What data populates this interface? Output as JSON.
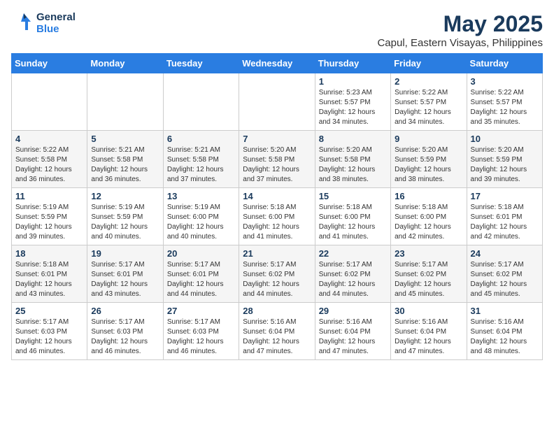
{
  "header": {
    "logo_line1": "General",
    "logo_line2": "Blue",
    "month": "May 2025",
    "location": "Capul, Eastern Visayas, Philippines"
  },
  "weekdays": [
    "Sunday",
    "Monday",
    "Tuesday",
    "Wednesday",
    "Thursday",
    "Friday",
    "Saturday"
  ],
  "weeks": [
    [
      {
        "day": "",
        "detail": ""
      },
      {
        "day": "",
        "detail": ""
      },
      {
        "day": "",
        "detail": ""
      },
      {
        "day": "",
        "detail": ""
      },
      {
        "day": "1",
        "detail": "Sunrise: 5:23 AM\nSunset: 5:57 PM\nDaylight: 12 hours\nand 34 minutes."
      },
      {
        "day": "2",
        "detail": "Sunrise: 5:22 AM\nSunset: 5:57 PM\nDaylight: 12 hours\nand 34 minutes."
      },
      {
        "day": "3",
        "detail": "Sunrise: 5:22 AM\nSunset: 5:57 PM\nDaylight: 12 hours\nand 35 minutes."
      }
    ],
    [
      {
        "day": "4",
        "detail": "Sunrise: 5:22 AM\nSunset: 5:58 PM\nDaylight: 12 hours\nand 36 minutes."
      },
      {
        "day": "5",
        "detail": "Sunrise: 5:21 AM\nSunset: 5:58 PM\nDaylight: 12 hours\nand 36 minutes."
      },
      {
        "day": "6",
        "detail": "Sunrise: 5:21 AM\nSunset: 5:58 PM\nDaylight: 12 hours\nand 37 minutes."
      },
      {
        "day": "7",
        "detail": "Sunrise: 5:20 AM\nSunset: 5:58 PM\nDaylight: 12 hours\nand 37 minutes."
      },
      {
        "day": "8",
        "detail": "Sunrise: 5:20 AM\nSunset: 5:58 PM\nDaylight: 12 hours\nand 38 minutes."
      },
      {
        "day": "9",
        "detail": "Sunrise: 5:20 AM\nSunset: 5:59 PM\nDaylight: 12 hours\nand 38 minutes."
      },
      {
        "day": "10",
        "detail": "Sunrise: 5:20 AM\nSunset: 5:59 PM\nDaylight: 12 hours\nand 39 minutes."
      }
    ],
    [
      {
        "day": "11",
        "detail": "Sunrise: 5:19 AM\nSunset: 5:59 PM\nDaylight: 12 hours\nand 39 minutes."
      },
      {
        "day": "12",
        "detail": "Sunrise: 5:19 AM\nSunset: 5:59 PM\nDaylight: 12 hours\nand 40 minutes."
      },
      {
        "day": "13",
        "detail": "Sunrise: 5:19 AM\nSunset: 6:00 PM\nDaylight: 12 hours\nand 40 minutes."
      },
      {
        "day": "14",
        "detail": "Sunrise: 5:18 AM\nSunset: 6:00 PM\nDaylight: 12 hours\nand 41 minutes."
      },
      {
        "day": "15",
        "detail": "Sunrise: 5:18 AM\nSunset: 6:00 PM\nDaylight: 12 hours\nand 41 minutes."
      },
      {
        "day": "16",
        "detail": "Sunrise: 5:18 AM\nSunset: 6:00 PM\nDaylight: 12 hours\nand 42 minutes."
      },
      {
        "day": "17",
        "detail": "Sunrise: 5:18 AM\nSunset: 6:01 PM\nDaylight: 12 hours\nand 42 minutes."
      }
    ],
    [
      {
        "day": "18",
        "detail": "Sunrise: 5:18 AM\nSunset: 6:01 PM\nDaylight: 12 hours\nand 43 minutes."
      },
      {
        "day": "19",
        "detail": "Sunrise: 5:17 AM\nSunset: 6:01 PM\nDaylight: 12 hours\nand 43 minutes."
      },
      {
        "day": "20",
        "detail": "Sunrise: 5:17 AM\nSunset: 6:01 PM\nDaylight: 12 hours\nand 44 minutes."
      },
      {
        "day": "21",
        "detail": "Sunrise: 5:17 AM\nSunset: 6:02 PM\nDaylight: 12 hours\nand 44 minutes."
      },
      {
        "day": "22",
        "detail": "Sunrise: 5:17 AM\nSunset: 6:02 PM\nDaylight: 12 hours\nand 44 minutes."
      },
      {
        "day": "23",
        "detail": "Sunrise: 5:17 AM\nSunset: 6:02 PM\nDaylight: 12 hours\nand 45 minutes."
      },
      {
        "day": "24",
        "detail": "Sunrise: 5:17 AM\nSunset: 6:02 PM\nDaylight: 12 hours\nand 45 minutes."
      }
    ],
    [
      {
        "day": "25",
        "detail": "Sunrise: 5:17 AM\nSunset: 6:03 PM\nDaylight: 12 hours\nand 46 minutes."
      },
      {
        "day": "26",
        "detail": "Sunrise: 5:17 AM\nSunset: 6:03 PM\nDaylight: 12 hours\nand 46 minutes."
      },
      {
        "day": "27",
        "detail": "Sunrise: 5:17 AM\nSunset: 6:03 PM\nDaylight: 12 hours\nand 46 minutes."
      },
      {
        "day": "28",
        "detail": "Sunrise: 5:16 AM\nSunset: 6:04 PM\nDaylight: 12 hours\nand 47 minutes."
      },
      {
        "day": "29",
        "detail": "Sunrise: 5:16 AM\nSunset: 6:04 PM\nDaylight: 12 hours\nand 47 minutes."
      },
      {
        "day": "30",
        "detail": "Sunrise: 5:16 AM\nSunset: 6:04 PM\nDaylight: 12 hours\nand 47 minutes."
      },
      {
        "day": "31",
        "detail": "Sunrise: 5:16 AM\nSunset: 6:04 PM\nDaylight: 12 hours\nand 48 minutes."
      }
    ]
  ]
}
